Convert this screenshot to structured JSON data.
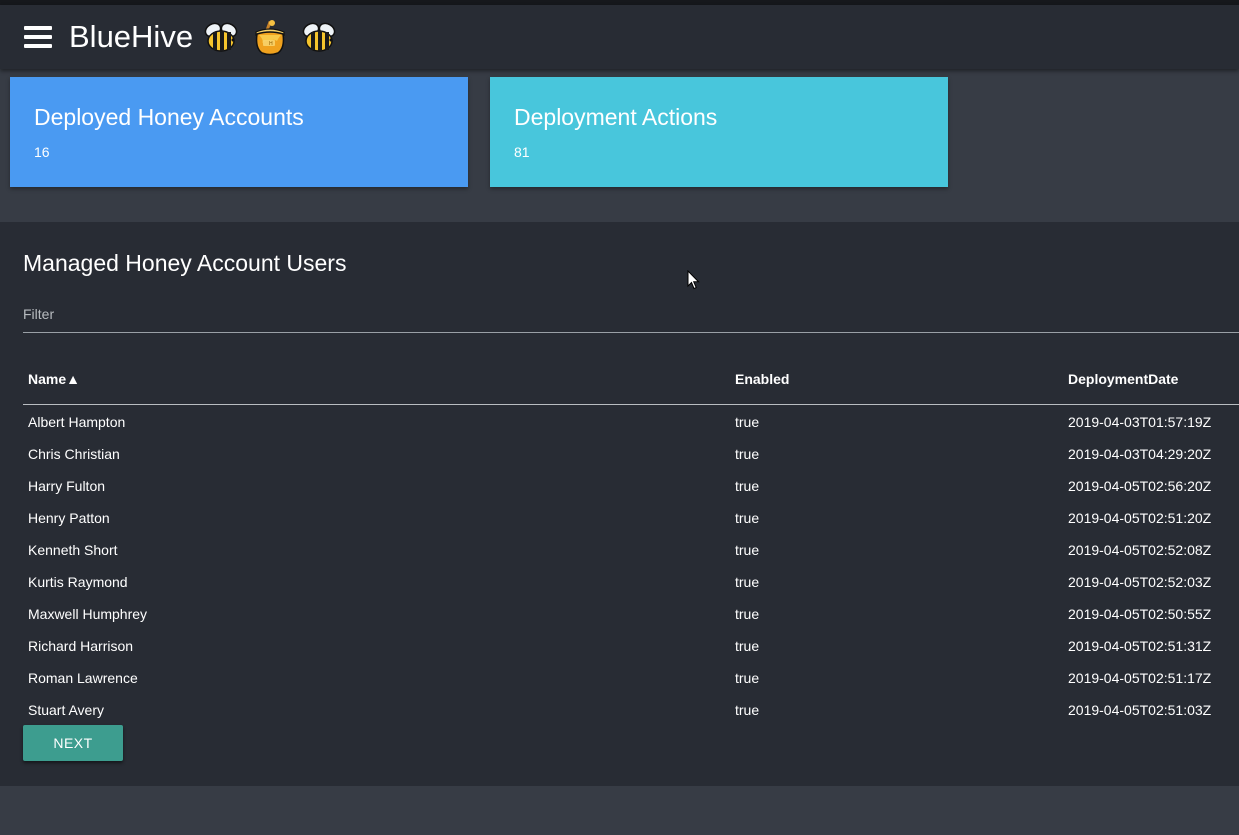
{
  "app": {
    "title": "BlueHive",
    "icons": [
      "bee-icon",
      "honey-pot-icon",
      "bee-icon"
    ]
  },
  "cards": [
    {
      "title": "Deployed Honey Accounts",
      "value": "16",
      "color": "#4a9af2"
    },
    {
      "title": "Deployment Actions",
      "value": "81",
      "color": "#48c6dc"
    }
  ],
  "table": {
    "title": "Managed Honey Account Users",
    "filter_placeholder": "Filter",
    "filter_value": "",
    "columns": [
      "Name▲",
      "Enabled",
      "DeploymentDate"
    ],
    "rows": [
      [
        "Albert Hampton",
        "true",
        "2019-04-03T01:57:19Z"
      ],
      [
        "Chris Christian",
        "true",
        "2019-04-03T04:29:20Z"
      ],
      [
        "Harry Fulton",
        "true",
        "2019-04-05T02:56:20Z"
      ],
      [
        "Henry Patton",
        "true",
        "2019-04-05T02:51:20Z"
      ],
      [
        "Kenneth Short",
        "true",
        "2019-04-05T02:52:08Z"
      ],
      [
        "Kurtis Raymond",
        "true",
        "2019-04-05T02:52:03Z"
      ],
      [
        "Maxwell Humphrey",
        "true",
        "2019-04-05T02:50:55Z"
      ],
      [
        "Richard Harrison",
        "true",
        "2019-04-05T02:51:31Z"
      ],
      [
        "Roman Lawrence",
        "true",
        "2019-04-05T02:51:17Z"
      ],
      [
        "Stuart Avery",
        "true",
        "2019-04-05T02:51:03Z"
      ]
    ],
    "next_label": "NEXT",
    "accent": "#3d9d8f"
  }
}
